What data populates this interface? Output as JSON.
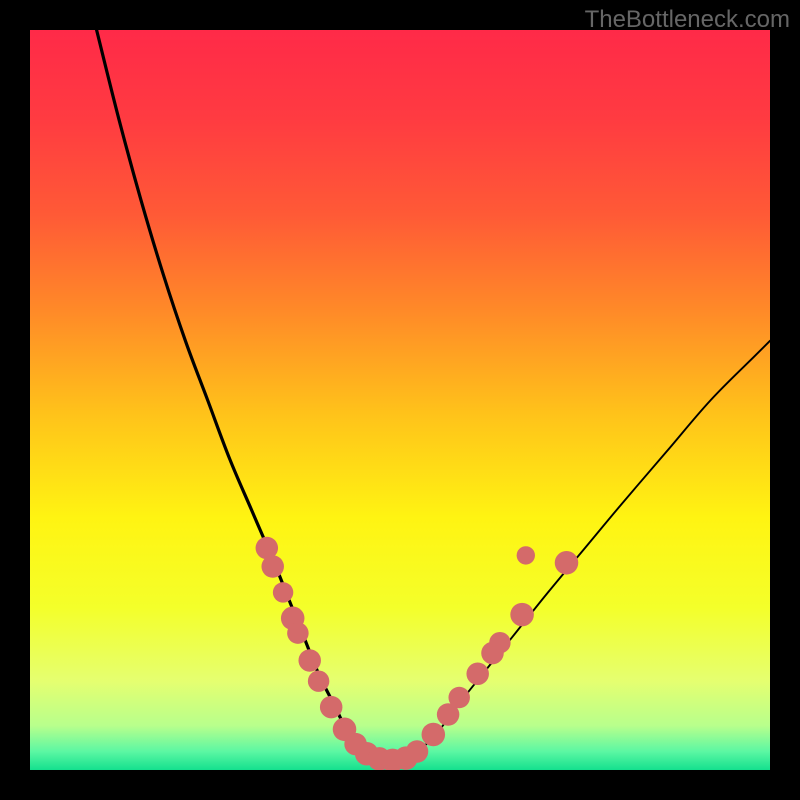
{
  "watermark": "TheBottleneck.com",
  "colors": {
    "frame": "#000000",
    "gradient_stops": [
      {
        "offset": 0.0,
        "color": "#ff2a48"
      },
      {
        "offset": 0.12,
        "color": "#ff3b41"
      },
      {
        "offset": 0.25,
        "color": "#ff5a36"
      },
      {
        "offset": 0.38,
        "color": "#ff8a28"
      },
      {
        "offset": 0.52,
        "color": "#ffc31a"
      },
      {
        "offset": 0.66,
        "color": "#fff412"
      },
      {
        "offset": 0.78,
        "color": "#f4ff2a"
      },
      {
        "offset": 0.88,
        "color": "#e5ff70"
      },
      {
        "offset": 0.94,
        "color": "#b8ff8c"
      },
      {
        "offset": 0.975,
        "color": "#5cf7a3"
      },
      {
        "offset": 1.0,
        "color": "#14e08e"
      }
    ],
    "curve": "#000000",
    "marker_fill": "#d46a6a",
    "marker_stroke": "#b85454"
  },
  "chart_data": {
    "type": "line",
    "title": "",
    "xlabel": "",
    "ylabel": "",
    "xlim": [
      0,
      100
    ],
    "ylim": [
      0,
      100
    ],
    "series": [
      {
        "name": "curve-left",
        "x": [
          9,
          12,
          15,
          18,
          21,
          24,
          27,
          30,
          33,
          35,
          37,
          39,
          41,
          43,
          45
        ],
        "y": [
          100,
          88,
          77,
          67,
          58,
          50,
          42,
          35,
          28,
          23,
          18,
          13,
          9,
          5,
          2
        ]
      },
      {
        "name": "curve-right",
        "x": [
          52,
          55,
          58,
          62,
          66,
          70,
          75,
          80,
          86,
          92,
          98,
          100
        ],
        "y": [
          2,
          5,
          9,
          14,
          19,
          24,
          30,
          36,
          43,
          50,
          56,
          58
        ]
      },
      {
        "name": "flat-bottom",
        "x": [
          45,
          47,
          49,
          51,
          52
        ],
        "y": [
          2,
          1.2,
          1.0,
          1.2,
          2
        ]
      }
    ],
    "markers": [
      {
        "x": 32.0,
        "y": 30.0,
        "r": 1.4
      },
      {
        "x": 32.8,
        "y": 27.5,
        "r": 1.4
      },
      {
        "x": 34.2,
        "y": 24.0,
        "r": 1.2
      },
      {
        "x": 35.5,
        "y": 20.5,
        "r": 1.5
      },
      {
        "x": 36.2,
        "y": 18.5,
        "r": 1.3
      },
      {
        "x": 37.8,
        "y": 14.8,
        "r": 1.4
      },
      {
        "x": 39.0,
        "y": 12.0,
        "r": 1.3
      },
      {
        "x": 40.7,
        "y": 8.5,
        "r": 1.4
      },
      {
        "x": 42.5,
        "y": 5.5,
        "r": 1.5
      },
      {
        "x": 44.0,
        "y": 3.5,
        "r": 1.4
      },
      {
        "x": 45.5,
        "y": 2.2,
        "r": 1.5
      },
      {
        "x": 47.2,
        "y": 1.5,
        "r": 1.5
      },
      {
        "x": 49.0,
        "y": 1.3,
        "r": 1.5
      },
      {
        "x": 50.8,
        "y": 1.6,
        "r": 1.5
      },
      {
        "x": 52.3,
        "y": 2.5,
        "r": 1.4
      },
      {
        "x": 54.5,
        "y": 4.8,
        "r": 1.5
      },
      {
        "x": 56.5,
        "y": 7.5,
        "r": 1.4
      },
      {
        "x": 58.0,
        "y": 9.8,
        "r": 1.3
      },
      {
        "x": 60.5,
        "y": 13.0,
        "r": 1.4
      },
      {
        "x": 62.5,
        "y": 15.8,
        "r": 1.4
      },
      {
        "x": 63.5,
        "y": 17.2,
        "r": 1.3
      },
      {
        "x": 66.5,
        "y": 21.0,
        "r": 1.5
      },
      {
        "x": 67.0,
        "y": 29.0,
        "r": 1.0
      },
      {
        "x": 72.5,
        "y": 28.0,
        "r": 1.5
      }
    ]
  }
}
